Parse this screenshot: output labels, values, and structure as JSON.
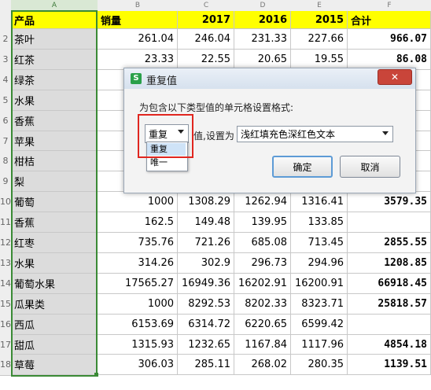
{
  "columns": [
    "A",
    "B",
    "C",
    "D",
    "E",
    "F"
  ],
  "header": {
    "product": "产品",
    "sales": "销量",
    "y2017": "2017",
    "y2016": "2016",
    "y2015": "2015",
    "total": "合计"
  },
  "rows": [
    {
      "num": "2",
      "product": "茶叶",
      "sales": "261.04",
      "y2017": "246.04",
      "y2016": "231.33",
      "y2015": "227.66",
      "total": "966.07"
    },
    {
      "num": "3",
      "product": "红茶",
      "sales": "23.33",
      "y2017": "22.55",
      "y2016": "20.65",
      "y2015": "19.55",
      "total": "86.08"
    },
    {
      "num": "4",
      "product": "绿茶",
      "sales": "",
      "y2017": "",
      "y2016": "",
      "y2015": "",
      "total": ""
    },
    {
      "num": "5",
      "product": "水果",
      "sales": "",
      "y2017": "",
      "y2016": "",
      "y2015": "",
      "total": ""
    },
    {
      "num": "6",
      "product": "香蕉",
      "sales": "",
      "y2017": "",
      "y2016": "",
      "y2015": "",
      "total": ""
    },
    {
      "num": "7",
      "product": "苹果",
      "sales": "",
      "y2017": "",
      "y2016": "",
      "y2015": "",
      "total": ""
    },
    {
      "num": "8",
      "product": "柑桔",
      "sales": "",
      "y2017": "",
      "y2016": "",
      "y2015": "",
      "total": ""
    },
    {
      "num": "9",
      "product": "梨",
      "sales": "",
      "y2017": "",
      "y2016": "",
      "y2015": "",
      "total": ""
    },
    {
      "num": "10",
      "product": "葡萄",
      "sales": "1000",
      "y2017": "1308.29",
      "y2016": "1262.94",
      "y2015": "1316.41",
      "total": "3579.35"
    },
    {
      "num": "11",
      "product": "香蕉",
      "sales": "162.5",
      "y2017": "149.48",
      "y2016": "139.95",
      "y2015": "133.85",
      "total": ""
    },
    {
      "num": "12",
      "product": "红枣",
      "sales": "735.76",
      "y2017": "721.26",
      "y2016": "685.08",
      "y2015": "713.45",
      "total": "2855.55"
    },
    {
      "num": "13",
      "product": "水果",
      "sales": "314.26",
      "y2017": "302.9",
      "y2016": "296.73",
      "y2015": "294.96",
      "total": "1208.85"
    },
    {
      "num": "14",
      "product": "葡萄水果",
      "sales": "17565.27",
      "y2017": "16949.36",
      "y2016": "16202.91",
      "y2015": "16200.91",
      "total": "66918.45"
    },
    {
      "num": "15",
      "product": "瓜果类",
      "sales": "1000",
      "y2017": "8292.53",
      "y2016": "8202.33",
      "y2015": "8323.71",
      "total": "25818.57"
    },
    {
      "num": "16",
      "product": "西瓜",
      "sales": "6153.69",
      "y2017": "6314.72",
      "y2016": "6220.65",
      "y2015": "6599.42",
      "total": ""
    },
    {
      "num": "17",
      "product": "甜瓜",
      "sales": "1315.93",
      "y2017": "1232.65",
      "y2016": "1167.84",
      "y2015": "1117.96",
      "total": "4854.18"
    },
    {
      "num": "18",
      "product": "草莓",
      "sales": "306.03",
      "y2017": "285.11",
      "y2016": "268.02",
      "y2015": "280.35",
      "total": "1139.51"
    }
  ],
  "dialog": {
    "app_icon": "S",
    "title": "重复值",
    "close_label": "✕",
    "prompt": "为包含以下类型值的单元格设置格式:",
    "type_selected": "重复",
    "set_label": "值,设置为",
    "format_selected": "浅红填充色深红色文本",
    "ok_label": "确定",
    "cancel_label": "取消",
    "type_options": [
      "重复",
      "唯一"
    ]
  },
  "colors": {
    "header_yellow": "#ffff00",
    "selection_green": "#3a8a35",
    "highlight_red": "#e0261f",
    "close_red": "#c9453a"
  }
}
